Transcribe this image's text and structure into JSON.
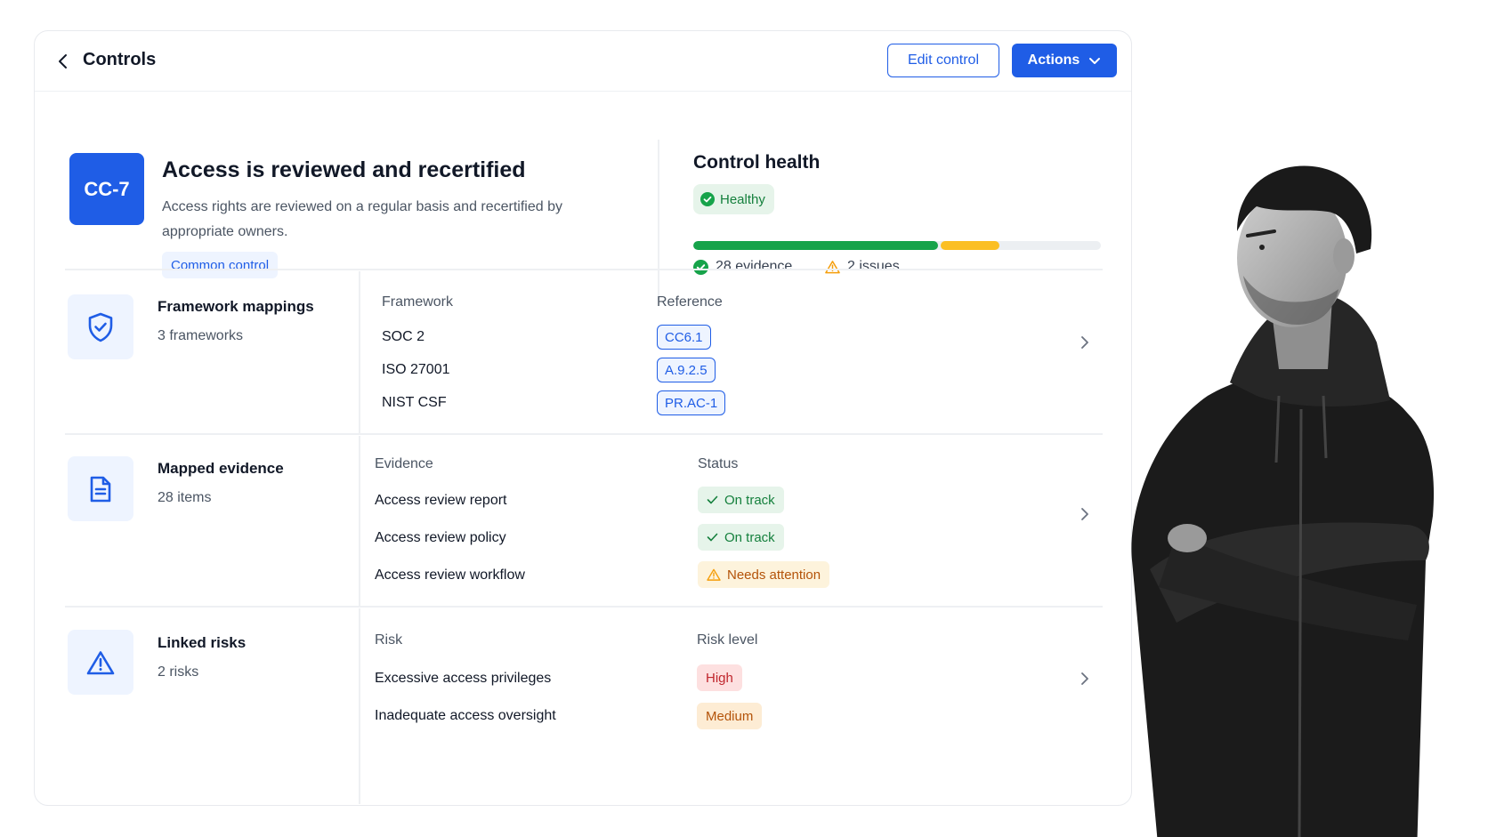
{
  "header": {
    "back_label": "Controls",
    "edit_label": "Edit control",
    "actions_label": "Actions"
  },
  "control": {
    "code": "CC-7",
    "title": "Access is reviewed and recertified",
    "description": "Access rights are reviewed on a regular basis and recertified by appropriate owners.",
    "tag": "Common control"
  },
  "health": {
    "title": "Control health",
    "status": "Healthy",
    "progress": {
      "evidence_fraction": 0.6,
      "issues_fraction": 0.145
    },
    "evidence_label": "28 evidence",
    "issues_label": "2 issues"
  },
  "frameworks": {
    "title": "Framework mappings",
    "subtitle": "3 frameworks",
    "col_framework": "Framework",
    "col_reference": "Reference",
    "rows": [
      {
        "framework": "SOC 2",
        "reference": "CC6.1"
      },
      {
        "framework": "ISO 27001",
        "reference": "A.9.2.5"
      },
      {
        "framework": "NIST CSF",
        "reference": "PR.AC-1"
      }
    ]
  },
  "evidence": {
    "title": "Mapped evidence",
    "subtitle": "28 items",
    "col_evidence": "Evidence",
    "col_status": "Status",
    "rows": [
      {
        "name": "Access review report",
        "status": "On track"
      },
      {
        "name": "Access review policy",
        "status": "On track"
      },
      {
        "name": "Access review workflow",
        "status": "Needs attention"
      }
    ]
  },
  "risks": {
    "title": "Linked risks",
    "subtitle": "2 risks",
    "col_risk": "Risk",
    "col_level": "Risk level",
    "rows": [
      {
        "name": "Excessive access privileges",
        "level": "High"
      },
      {
        "name": "Inadequate access oversight",
        "level": "Medium"
      }
    ]
  },
  "colors": {
    "primary": "#1f5de6",
    "success": "#16a34a",
    "warning": "#fbbf24",
    "danger": "#c0262d"
  }
}
